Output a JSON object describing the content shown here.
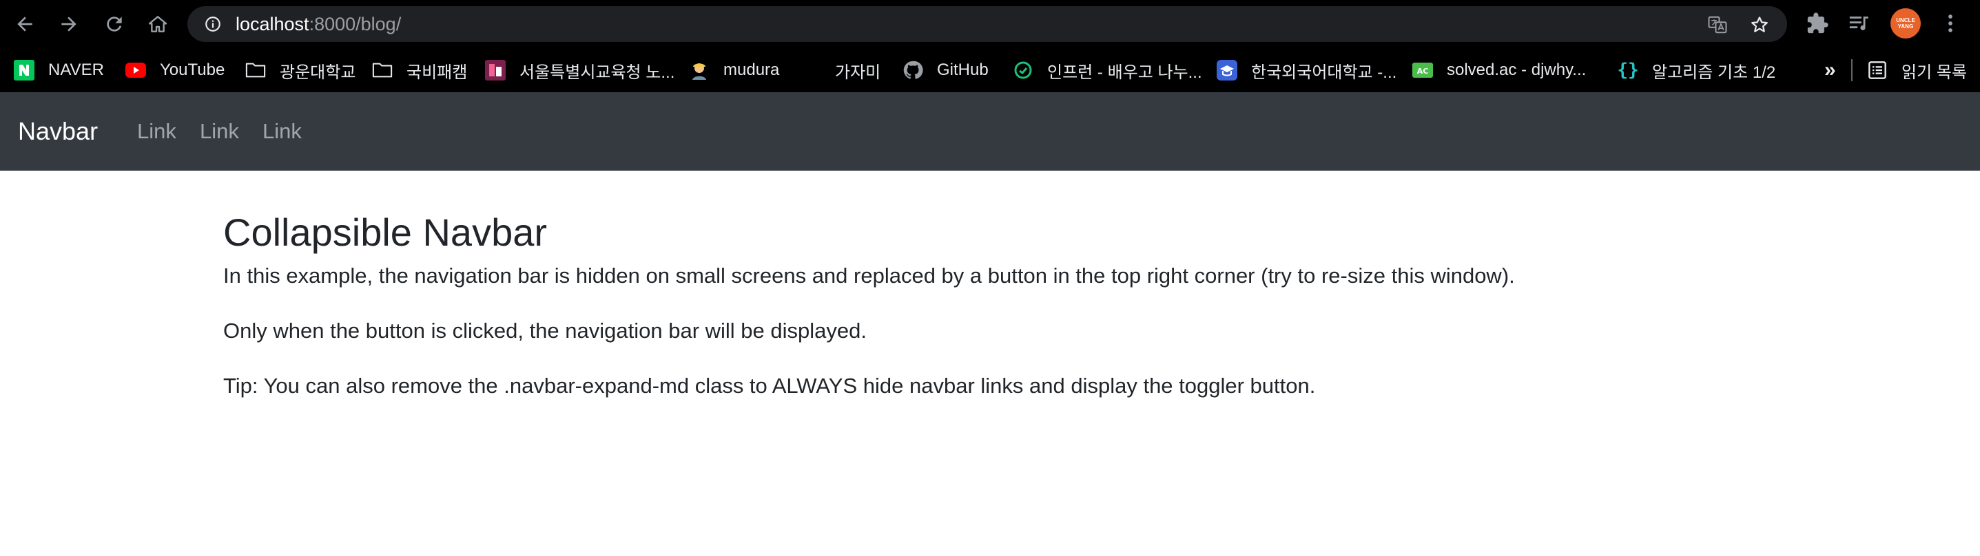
{
  "browser": {
    "url_host": "localhost",
    "url_rest": ":8000/blog/",
    "avatar_text": "UNCLE YANG",
    "bookmarks": [
      {
        "label": "NAVER",
        "icon": "naver-icon",
        "color": "#03c75a"
      },
      {
        "label": "YouTube",
        "icon": "youtube-icon",
        "color": "#ff0000"
      },
      {
        "label": "광운대학교",
        "icon": "folder-icon"
      },
      {
        "label": "국비패캠",
        "icon": "folder-icon"
      },
      {
        "label": "서울특별시교육청 노...",
        "icon": "seoul-edu-icon",
        "color": "#7b1f4d"
      },
      {
        "label": "mudura",
        "icon": "mudura-avatar-icon"
      },
      {
        "label": "가자미",
        "icon": "blank-icon"
      },
      {
        "label": "GitHub",
        "icon": "github-icon"
      },
      {
        "label": "인프런 - 배우고 나누...",
        "icon": "inflearn-icon",
        "color": "#1dc078"
      },
      {
        "label": "한국외국어대학교 -...",
        "icon": "hufs-icon",
        "color": "#3b63d8"
      },
      {
        "label": "solved.ac - djwhy...",
        "icon": "solved-ac-icon",
        "color": "#4bbd4b"
      },
      {
        "label": "알고리즘 기초 1/2",
        "icon": "code-braces-icon",
        "color": "#23c6c8"
      }
    ],
    "overflow_label": "»",
    "reading_list_label": "읽기 목록"
  },
  "navbar": {
    "brand": "Navbar",
    "links": [
      "Link",
      "Link",
      "Link"
    ]
  },
  "main": {
    "title": "Collapsible Navbar",
    "paragraphs": [
      "In this example, the navigation bar is hidden on small screens and replaced by a button in the top right corner (try to re-size this window).",
      "Only when the button is clicked, the navigation bar will be displayed.",
      "Tip: You can also remove the .navbar-expand-md class to ALWAYS hide navbar links and display the toggler button."
    ]
  },
  "colors": {
    "navbar_bg": "#343a40",
    "chrome_bg": "#000000",
    "omnibox_bg": "#202124",
    "text": "#212529"
  }
}
